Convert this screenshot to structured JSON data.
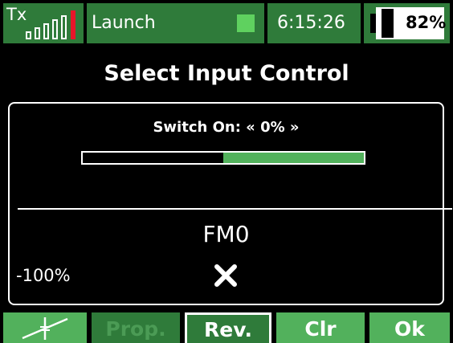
{
  "status_bar": {
    "tx_label": "Tx",
    "model_name": "Launch",
    "time": "6:15:26",
    "battery_percent": "82%",
    "battery_level": 0.82,
    "signal_level_bars": 0,
    "icons": {
      "signal": "signal-bars-icon",
      "model_indicator": "model-indicator-icon",
      "battery": "battery-icon"
    }
  },
  "page": {
    "title": "Select Input Control"
  },
  "switch": {
    "title": "Switch On: « 0% »",
    "value_percent": 0
  },
  "input": {
    "name": "FM0",
    "min_value": "-100%",
    "state_icon": "close-icon"
  },
  "softkeys": {
    "trim_icon": "trim-icon",
    "prop_label": "Prop.",
    "rev_label": "Rev.",
    "clr_label": "Clr",
    "ok_label": "Ok"
  },
  "colors": {
    "accent": "#52b15c",
    "dark_accent": "#2f7b3a",
    "alert": "#e8162a",
    "background": "#000000",
    "foreground": "#ffffff"
  }
}
